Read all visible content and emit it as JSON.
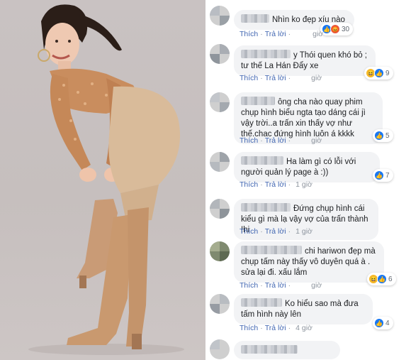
{
  "colors": {
    "link": "#4267b2",
    "meta": "#8d949e",
    "bubble": "#f2f3f5",
    "like": "#1877f2",
    "angry": "#e9573f",
    "haha": "#f7b928"
  },
  "actions": {
    "like_label": "Thích",
    "reply_label": "Trả lời"
  },
  "comments": [
    {
      "text": "Nhìn ko đẹp xíu nào",
      "time": "giờ",
      "reactions": [
        "like",
        "angry"
      ],
      "count": "30"
    },
    {
      "text": "y Thói quen khó bỏ ; tư thế La Hán Đẩy xe",
      "time": "giờ",
      "reactions": [
        "haha",
        "like"
      ],
      "count": "9"
    },
    {
      "text": "ông cha nào quay phim chụp hình biểu ngta tạo dáng cái jì vậy trời..a trấn xin thấy vợ như thế.chac đứng hình luôn á kkkk",
      "time": "giờ",
      "reactions": [
        "like"
      ],
      "count": "5"
    },
    {
      "text": "Ha làm gì có lỗi với người quản lý page à :))",
      "time": "1 giờ",
      "reactions": [
        "like"
      ],
      "count": "7"
    },
    {
      "text": "Đứng chụp hình cái kiểu gì mà lạ vậy vợ của trấn thành !hi",
      "time": "1 giờ",
      "reactions": [],
      "count": ""
    },
    {
      "text": "chi hariwon đẹp mà chụp tấm này thấy vô duyên quá à . sửa lại đi. xấu lắm",
      "time": "giờ",
      "reactions": [
        "haha",
        "like"
      ],
      "count": "6"
    },
    {
      "text": "Ko hiểu sao mà đưa tấm hình này lên",
      "time": "4 giờ",
      "reactions": [
        "like"
      ],
      "count": "4"
    }
  ]
}
